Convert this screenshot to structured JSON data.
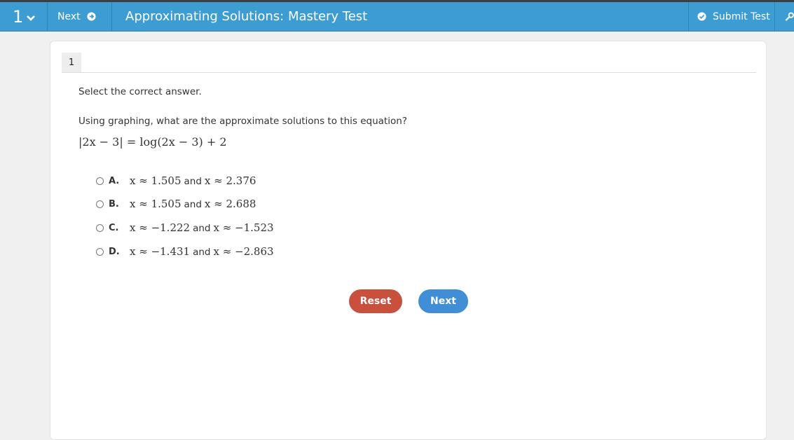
{
  "header": {
    "question_number": "1",
    "next_label": "Next",
    "title": "Approximating Solutions: Mastery Test",
    "submit_label": "Submit Test"
  },
  "question": {
    "tab_number": "1",
    "instruction": "Select the correct answer.",
    "prompt": "Using graphing, what are the approximate solutions to this equation?",
    "equation": "|2x − 3| = log(2x − 3) + 2",
    "options": [
      {
        "letter": "A.",
        "first": "x ≈ 1.505",
        "and": "and",
        "second": "x ≈ 2.376"
      },
      {
        "letter": "B.",
        "first": "x ≈ 1.505",
        "and": "and",
        "second": "x ≈ 2.688"
      },
      {
        "letter": "C.",
        "first": "x ≈ −1.222",
        "and": "and",
        "second": "x ≈ −1.523"
      },
      {
        "letter": "D.",
        "first": "x ≈ −1.431",
        "and": "and",
        "second": "x ≈ −2.863"
      }
    ]
  },
  "buttons": {
    "reset_label": "Reset",
    "next_label": "Next"
  },
  "colors": {
    "header_bg": "#3d9dd3",
    "reset_bg": "#c8503d",
    "next_bg": "#3f8ed6"
  },
  "icons": {
    "question_menu": "chevron-down-icon",
    "next": "arrow-circle-right-icon",
    "submit": "check-circle-icon",
    "tools": "wrench-icon"
  }
}
